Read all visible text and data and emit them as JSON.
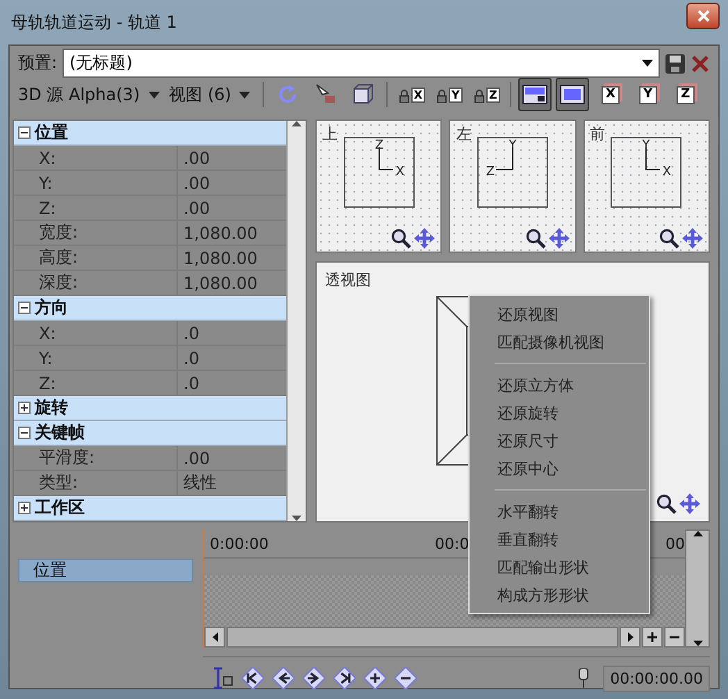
{
  "window": {
    "title": "母轨轨道运动 - 轨道 1"
  },
  "preset": {
    "label": "预置:",
    "value": "(无标题)"
  },
  "toolbar": {
    "source": "3D 源 Alpha(3)",
    "view": "视图 (6)",
    "buttons": [
      {
        "kind": "rotate",
        "selected": false
      },
      {
        "kind": "pointer",
        "selected": false
      },
      {
        "kind": "cube",
        "selected": false
      },
      {
        "kind": "lock",
        "axis": "X",
        "selected": false
      },
      {
        "kind": "lock",
        "axis": "Y",
        "selected": false
      },
      {
        "kind": "lock",
        "axis": "Z",
        "selected": false
      },
      {
        "kind": "layout-split",
        "selected": true
      },
      {
        "kind": "layout-single",
        "selected": true
      },
      {
        "kind": "axis-cube",
        "axis": "X",
        "selected": false
      },
      {
        "kind": "axis-cube",
        "axis": "Y",
        "selected": false
      },
      {
        "kind": "axis-cube",
        "axis": "Z",
        "selected": false
      }
    ]
  },
  "properties": [
    {
      "title": "位置",
      "expanded": true,
      "rows": [
        {
          "label": "X:",
          "value": ".00"
        },
        {
          "label": "Y:",
          "value": ".00"
        },
        {
          "label": "Z:",
          "value": ".00"
        },
        {
          "label": "宽度:",
          "value": "1,080.00"
        },
        {
          "label": "高度:",
          "value": "1,080.00"
        },
        {
          "label": "深度:",
          "value": "1,080.00"
        }
      ]
    },
    {
      "title": "方向",
      "expanded": true,
      "rows": [
        {
          "label": "X:",
          "value": ".0"
        },
        {
          "label": "Y:",
          "value": ".0"
        },
        {
          "label": "Z:",
          "value": ".0"
        }
      ]
    },
    {
      "title": "旋转",
      "expanded": false
    },
    {
      "title": "关键帧",
      "expanded": true,
      "rows": [
        {
          "label": "平滑度:",
          "value": ".00"
        },
        {
          "label": "类型:",
          "value": "线性"
        }
      ]
    },
    {
      "title": "工作区",
      "expanded": false
    }
  ],
  "views": [
    {
      "label": "上",
      "axis_vertical": "Z",
      "axis_horizontal": "X",
      "kind": "standard"
    },
    {
      "label": "左",
      "axis_vertical": "Y",
      "axis_horizontal": "Z",
      "kind": "mirrored"
    },
    {
      "label": "前",
      "axis_vertical": "Y",
      "axis_horizontal": "X",
      "kind": "standard"
    }
  ],
  "perspective": {
    "label": "透视图"
  },
  "context_menu": [
    [
      "还原视图",
      "匹配摄像机视图"
    ],
    [
      "还原立方体",
      "还原旋转",
      "还原尺寸",
      "还原中心"
    ],
    [
      "水平翻转",
      "垂直翻转",
      "匹配输出形状",
      "构成方形形状"
    ]
  ],
  "timeline": {
    "tracks": [
      {
        "label": "位置",
        "selected": true
      }
    ],
    "ruler": [
      "0:00:00",
      "00:0",
      "00"
    ],
    "keyframe_buttons": [
      {
        "kind": "first"
      },
      {
        "kind": "prev"
      },
      {
        "kind": "next"
      },
      {
        "kind": "last"
      },
      {
        "kind": "add"
      },
      {
        "kind": "remove"
      }
    ],
    "timecode": "00:00:00.00"
  }
}
